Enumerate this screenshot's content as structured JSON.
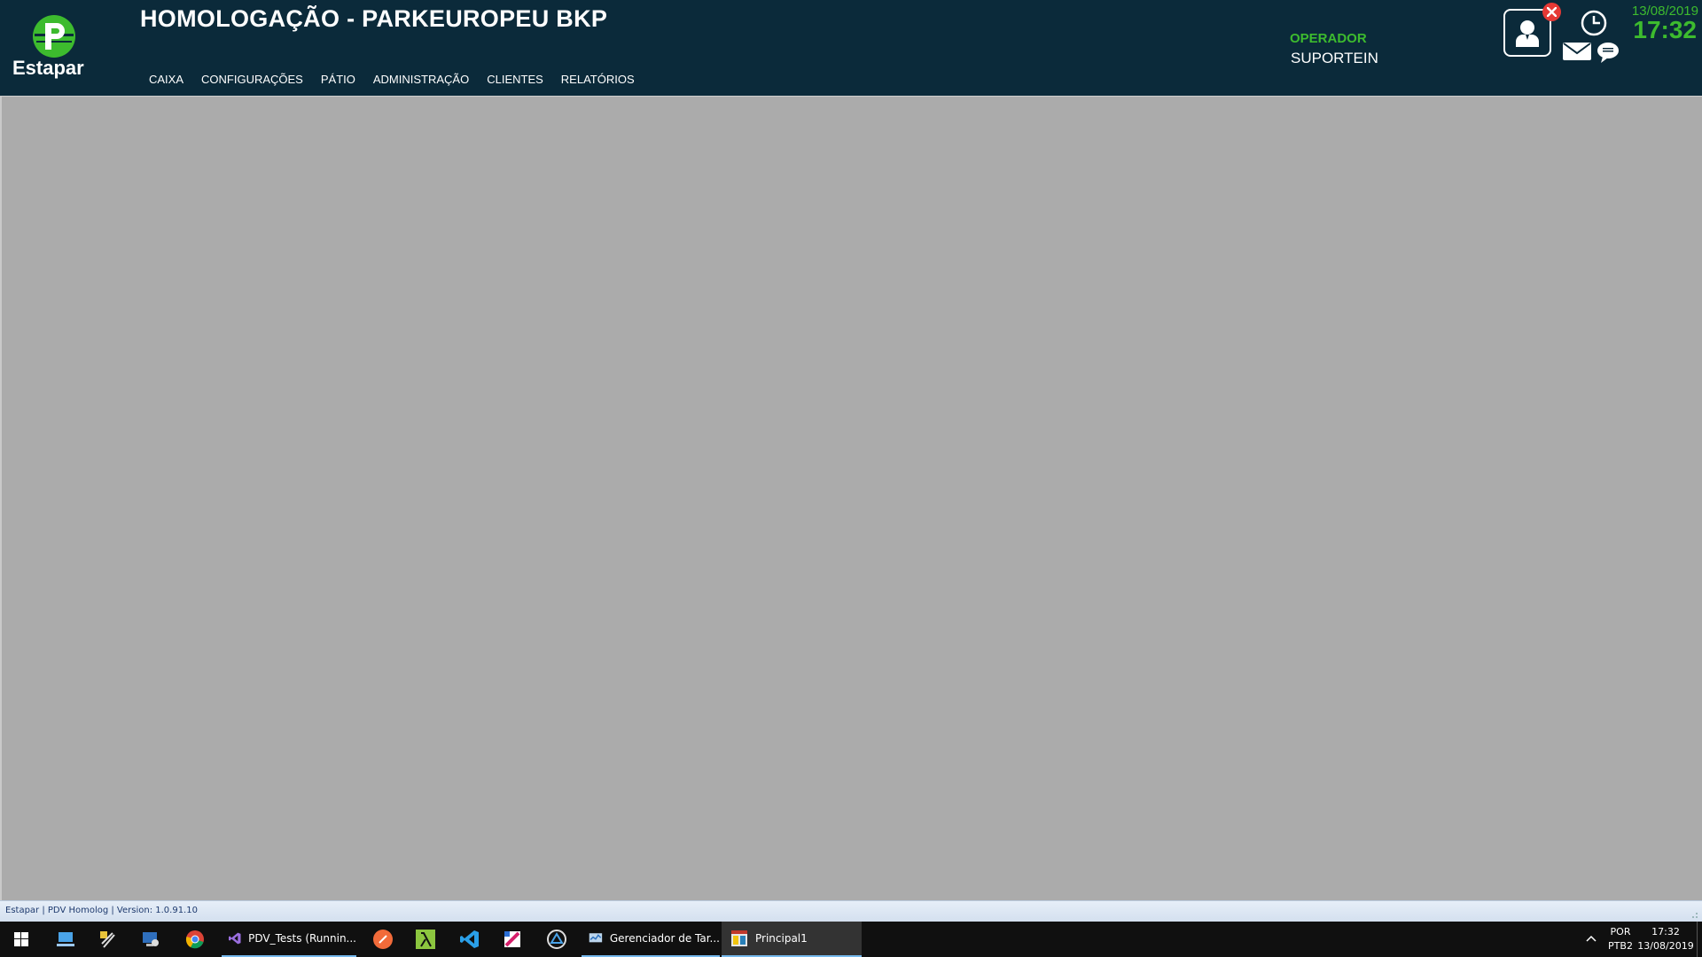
{
  "header": {
    "logo_text": "Estapar",
    "title": "HOMOLOGAÇÃO - PARKEUROPEU BKP",
    "menu": [
      {
        "label": "CAIXA"
      },
      {
        "label": "CONFIGURAÇÕES"
      },
      {
        "label": "PÁTIO"
      },
      {
        "label": "ADMINISTRAÇÃO"
      },
      {
        "label": "CLIENTES"
      },
      {
        "label": "RELATÓRIOS"
      }
    ],
    "operator_label": "OPERADOR",
    "operator_name": "SUPORTEIN",
    "date": "13/08/2019",
    "time": "17:32",
    "icons": [
      "user-icon",
      "close-icon",
      "clock-icon",
      "mail-icon",
      "chat-icon"
    ]
  },
  "statusbar": {
    "text": "Estapar | PDV Homolog | Version: 1.0.91.10"
  },
  "taskbar": {
    "pinned_icons": [
      "windows-start-icon",
      "network-computer-icon",
      "tools-icon",
      "remote-desktop-icon",
      "chrome-icon"
    ],
    "apps": [
      {
        "label": "PDV_Tests (Runnin...",
        "icon": "visual-studio-icon"
      },
      {
        "label": "Gerenciador de Tar...",
        "icon": "task-manager-icon"
      },
      {
        "label": "Principal1",
        "icon": "app-window-icon"
      }
    ],
    "extra_icons": [
      "postman-icon",
      "lambda-icon",
      "vscode-icon",
      "paint-icon",
      "triangle-app-icon"
    ],
    "lang_line1": "POR",
    "lang_line2": "PTB2",
    "clock_time": "17:32",
    "clock_date": "13/08/2019"
  },
  "colors": {
    "header_bg": "#0b2a3a",
    "accent_green": "#3dbb2e",
    "workarea_bg": "#ababab",
    "taskbar_bg": "#101010"
  }
}
